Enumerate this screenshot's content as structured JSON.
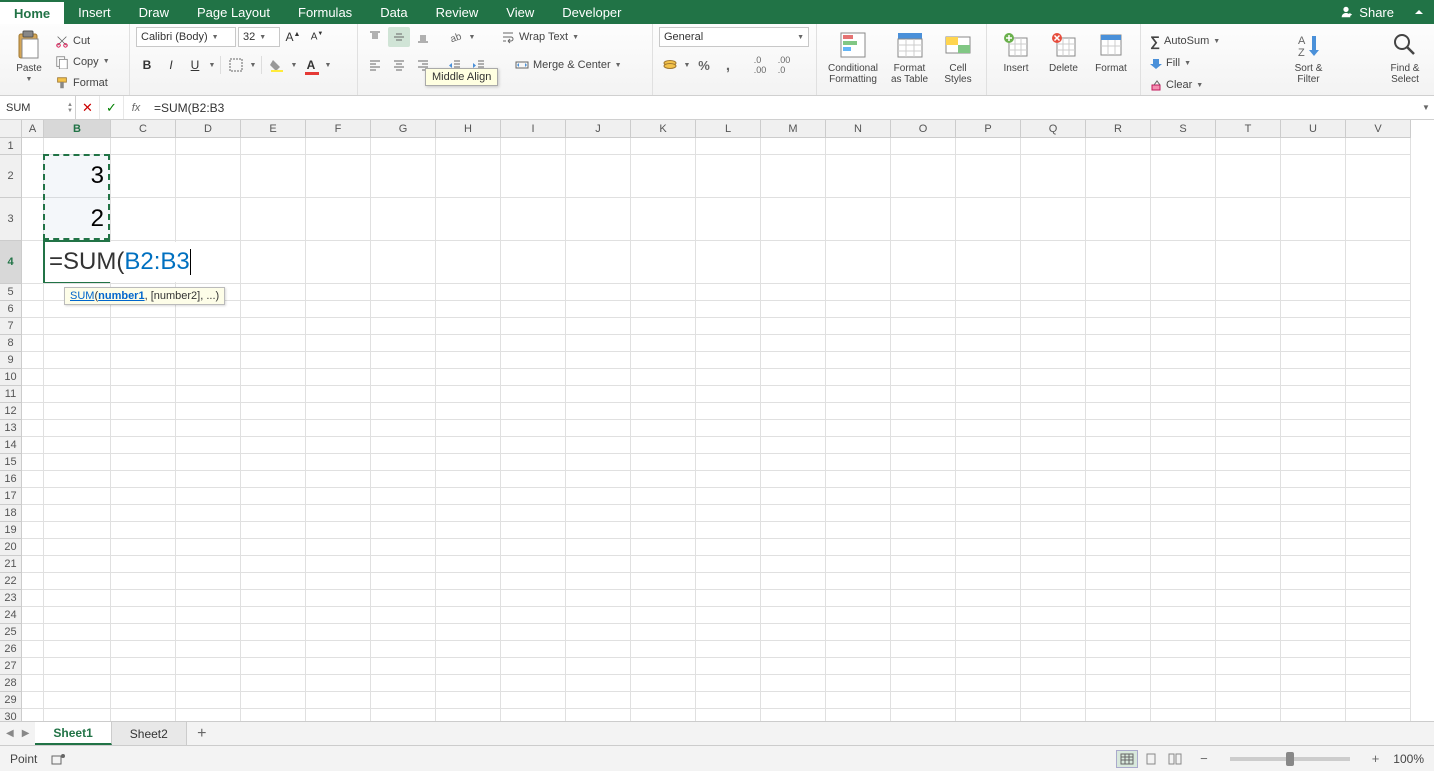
{
  "tabs": [
    "Home",
    "Insert",
    "Draw",
    "Page Layout",
    "Formulas",
    "Data",
    "Review",
    "View",
    "Developer"
  ],
  "active_tab": "Home",
  "share_label": "Share",
  "clipboard": {
    "paste": "Paste",
    "cut": "Cut",
    "copy": "Copy",
    "format": "Format"
  },
  "font": {
    "name": "Calibri (Body)",
    "size": "32"
  },
  "tooltip": "Middle Align",
  "alignment": {
    "wrap": "Wrap Text",
    "merge": "Merge & Center"
  },
  "number_format": "General",
  "styles": {
    "conditional": "Conditional\nFormatting",
    "table": "Format\nas Table",
    "cell": "Cell\nStyles"
  },
  "cells_group": {
    "insert": "Insert",
    "delete": "Delete",
    "format": "Format"
  },
  "editing": {
    "autosum": "AutoSum",
    "fill": "Fill",
    "clear": "Clear",
    "sort": "Sort &\nFilter",
    "find": "Find &\nSelect"
  },
  "name_box": "SUM",
  "formula_bar": "=SUM(B2:B3",
  "columns": [
    "A",
    "B",
    "C",
    "D",
    "E",
    "F",
    "G",
    "H",
    "I",
    "J",
    "K",
    "L",
    "M",
    "N",
    "O",
    "P",
    "Q",
    "R",
    "S",
    "T",
    "U",
    "V"
  ],
  "col_widths_first": [
    22,
    67
  ],
  "default_col_width": 65,
  "row_heights": {
    "default": 17,
    "tall": 43
  },
  "tall_rows": [
    2,
    3,
    4
  ],
  "total_rows": 31,
  "active_col": "B",
  "active_row": 4,
  "selection_range": {
    "top_row": 2,
    "bottom_row": 3,
    "col": "B"
  },
  "cell_values": {
    "B2": "3",
    "B3": "2"
  },
  "editing_cell": {
    "ref": "B4",
    "prefix": "=SUM(",
    "range": "B2:B3",
    "suffix": ""
  },
  "func_hint": {
    "fn": "SUM",
    "current_arg": "number1",
    "rest": ", [number2], ...)"
  },
  "sheets": [
    "Sheet1",
    "Sheet2"
  ],
  "active_sheet": "Sheet1",
  "status_mode": "Point",
  "zoom": "100%"
}
